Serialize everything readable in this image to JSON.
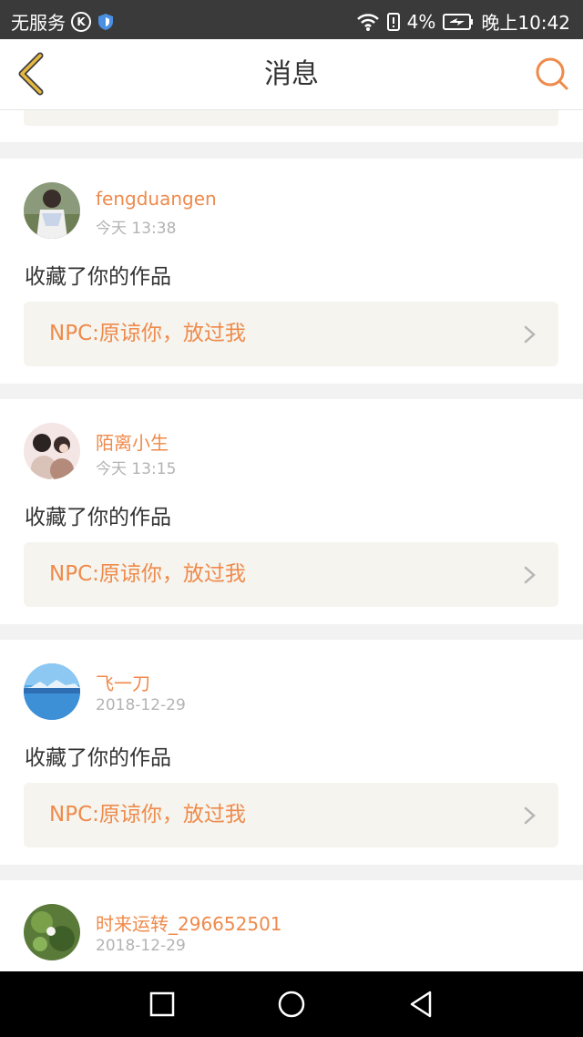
{
  "status_bar": {
    "carrier": "无服务",
    "k_badge": "K",
    "battery_percent": "4%",
    "time": "晚上10:42"
  },
  "header": {
    "title": "消息"
  },
  "messages": [
    {
      "username": "fengduangen",
      "time": "今天 13:38",
      "action": "收藏了你的作品",
      "work_title": "NPC:原谅你，放过我"
    },
    {
      "username": "陌离小生",
      "time": "今天 13:15",
      "action": "收藏了你的作品",
      "work_title": "NPC:原谅你，放过我"
    },
    {
      "username": "飞一刀",
      "time": "2018-12-29",
      "action": "收藏了你的作品",
      "work_title": "NPC:原谅你，放过我"
    },
    {
      "username": "时来运转_296652501",
      "time": "2018-12-29"
    }
  ],
  "colors": {
    "accent": "#ef8a4b",
    "back_arrow": "#e7b940",
    "link_bg": "#f5f4ee"
  }
}
